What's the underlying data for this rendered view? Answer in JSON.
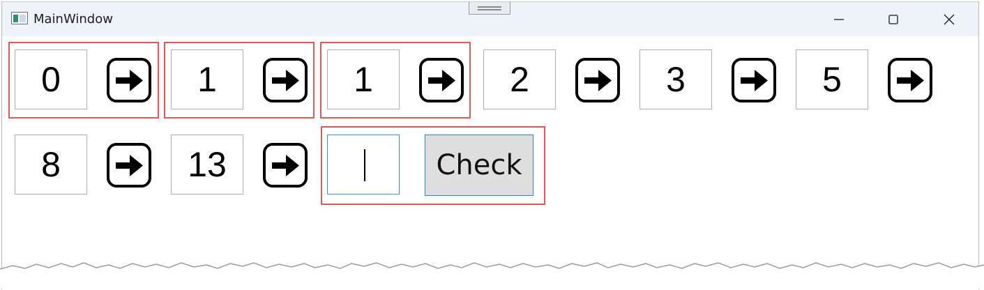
{
  "window": {
    "title": "MainWindow"
  },
  "numbers": [
    "0",
    "1",
    "1",
    "2",
    "3",
    "5",
    "8",
    "13"
  ],
  "answer_input": {
    "value": ""
  },
  "check_button": {
    "label": "Check"
  }
}
